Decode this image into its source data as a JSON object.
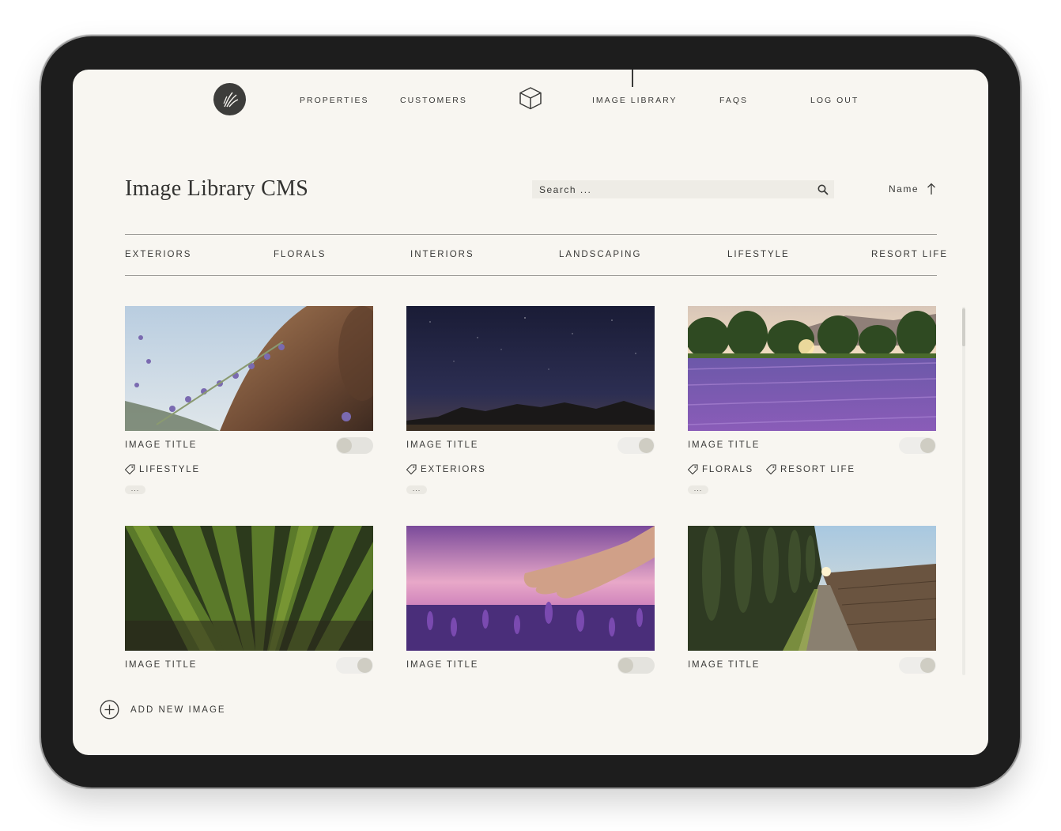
{
  "nav": {
    "logo_icon": "lavender-sprig-logo-icon",
    "center_icon": "cube-icon",
    "links": [
      {
        "label": "PROPERTIES"
      },
      {
        "label": "CUSTOMERS"
      },
      {
        "label": "IMAGE LIBRARY",
        "active": true
      },
      {
        "label": "FAQS"
      },
      {
        "label": "LOG OUT"
      }
    ]
  },
  "header": {
    "title": "Image Library CMS",
    "search_placeholder": "Search ...",
    "search_icon": "search-icon",
    "sort_label": "Name",
    "sort_icon": "arrow-up-icon"
  },
  "categories": [
    "EXTERIORS",
    "FLORALS",
    "INTERIORS",
    "LANDSCAPING",
    "LIFESTYLE",
    "RESORT LIFE"
  ],
  "images": [
    {
      "title": "IMAGE TITLE",
      "enabled": false,
      "tags": [
        "LIFESTYLE"
      ],
      "more": "..."
    },
    {
      "title": "IMAGE TITLE",
      "enabled": true,
      "tags": [
        "EXTERIORS"
      ],
      "more": "..."
    },
    {
      "title": "IMAGE TITLE",
      "enabled": true,
      "tags": [
        "FLORALS",
        "RESORT LIFE"
      ],
      "more": "..."
    },
    {
      "title": "IMAGE TITLE",
      "enabled": true,
      "tags": [],
      "more": ""
    },
    {
      "title": "IMAGE TITLE",
      "enabled": false,
      "tags": [],
      "more": ""
    },
    {
      "title": "IMAGE TITLE",
      "enabled": true,
      "tags": [],
      "more": ""
    }
  ],
  "add_new": {
    "label": "ADD NEW IMAGE",
    "icon": "plus-circle-icon"
  },
  "colors": {
    "background": "#f8f6f1",
    "text": "#3a3a38",
    "search_bg": "#eeece6",
    "device_frame": "#1d1d1d"
  }
}
